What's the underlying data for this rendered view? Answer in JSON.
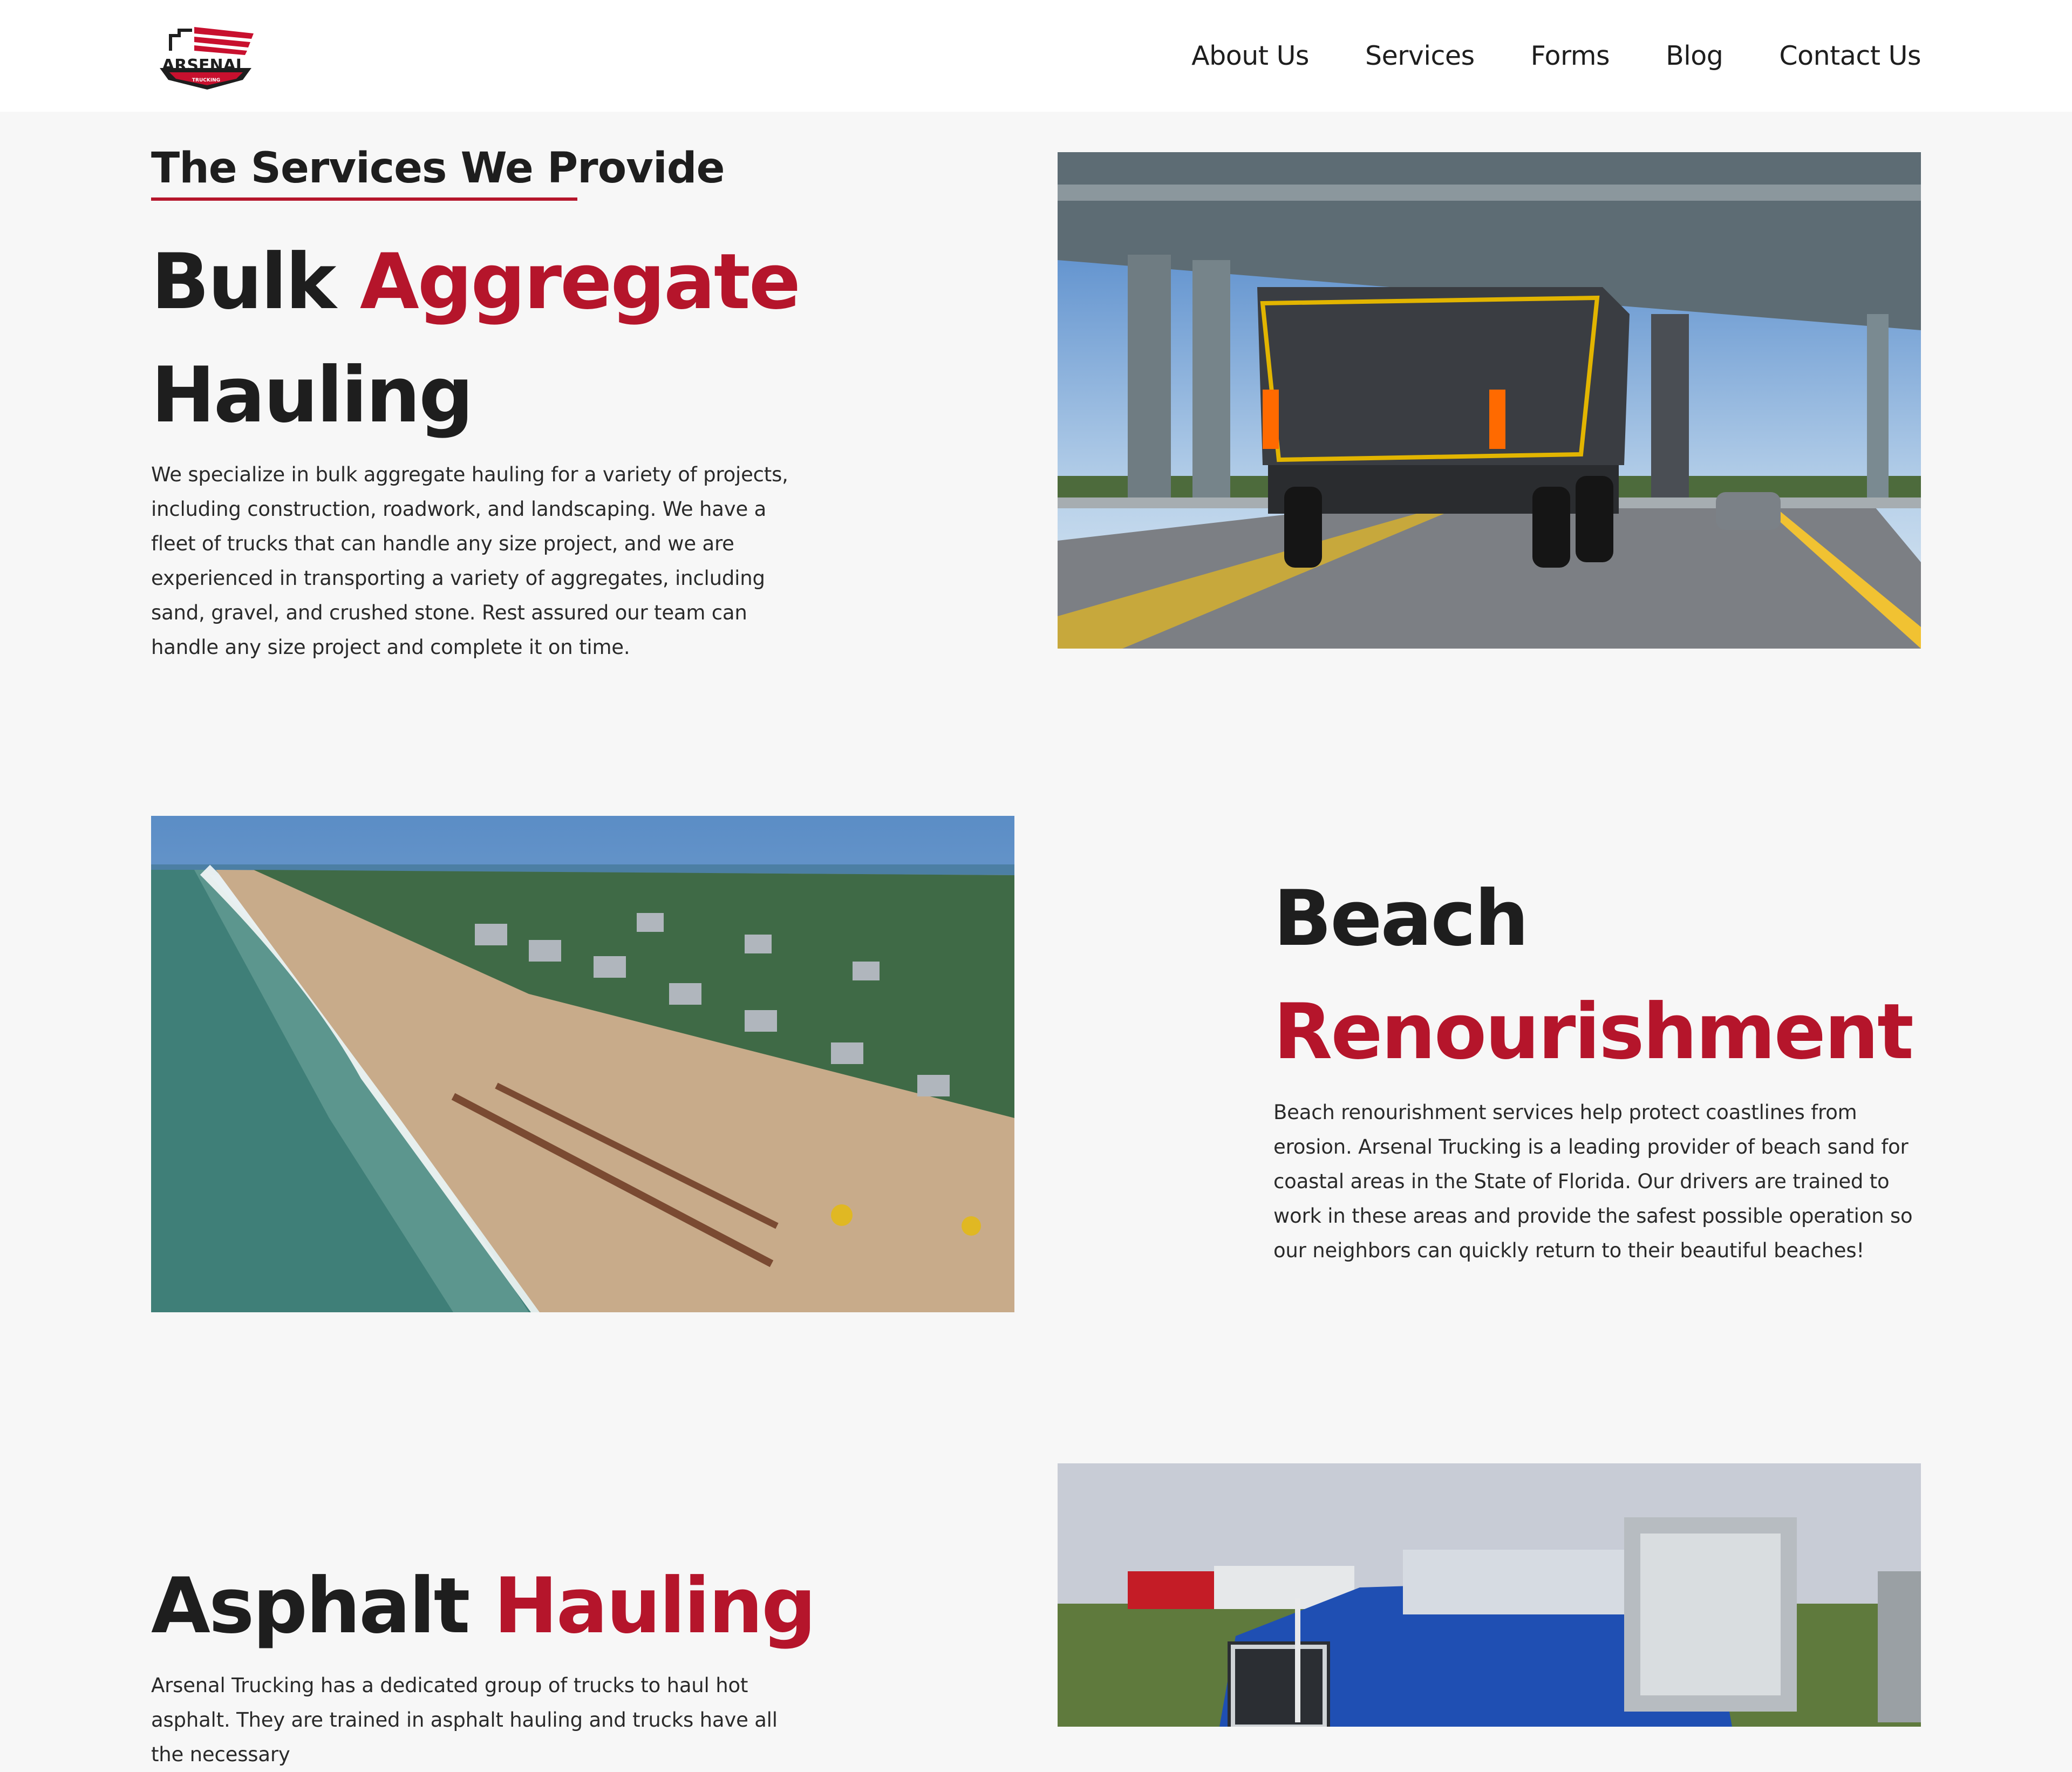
{
  "header": {
    "logo_text": "ARSENAL",
    "logo_subtext": "TRUCKING",
    "nav": [
      "About Us",
      "Services",
      "Forms",
      "Blog",
      "Contact Us"
    ]
  },
  "services_section": {
    "eyebrow": "The Services We Provide",
    "items": [
      {
        "title_plain": "Bulk",
        "title_accent": "Aggregate",
        "title_plain_2": "Hauling",
        "description": "We specialize in bulk aggregate hauling for a variety of projects, including construction, roadwork, and landscaping. We have a fleet of trucks that can handle any size project, and we are experienced in transporting a variety of aggregates, including sand, gravel, and crushed stone. Rest assured our team can handle any size project and complete it on time.",
        "image": "dump-truck-under-overpass"
      },
      {
        "title_plain": "Beach",
        "title_accent": "Renourishment",
        "description": "Beach renourishment services help protect coastlines from erosion. Arsenal Trucking is a leading provider of beach sand for coastal areas in the State of Florida. Our drivers are trained to work in these areas and provide the safest possible operation so our neighbors can quickly return to their beautiful beaches!",
        "image": "aerial-beach-renourishment"
      },
      {
        "title_plain": "Asphalt",
        "title_accent": "Hauling",
        "description": "Arsenal Trucking has a dedicated group of trucks to haul hot asphalt. They are trained in asphalt hauling and trucks have all the necessary",
        "image": "blue-semi-truck"
      }
    ]
  },
  "colors": {
    "accent": "#b5152b",
    "background": "#f7f7f7",
    "text": "#1e1e1e"
  }
}
